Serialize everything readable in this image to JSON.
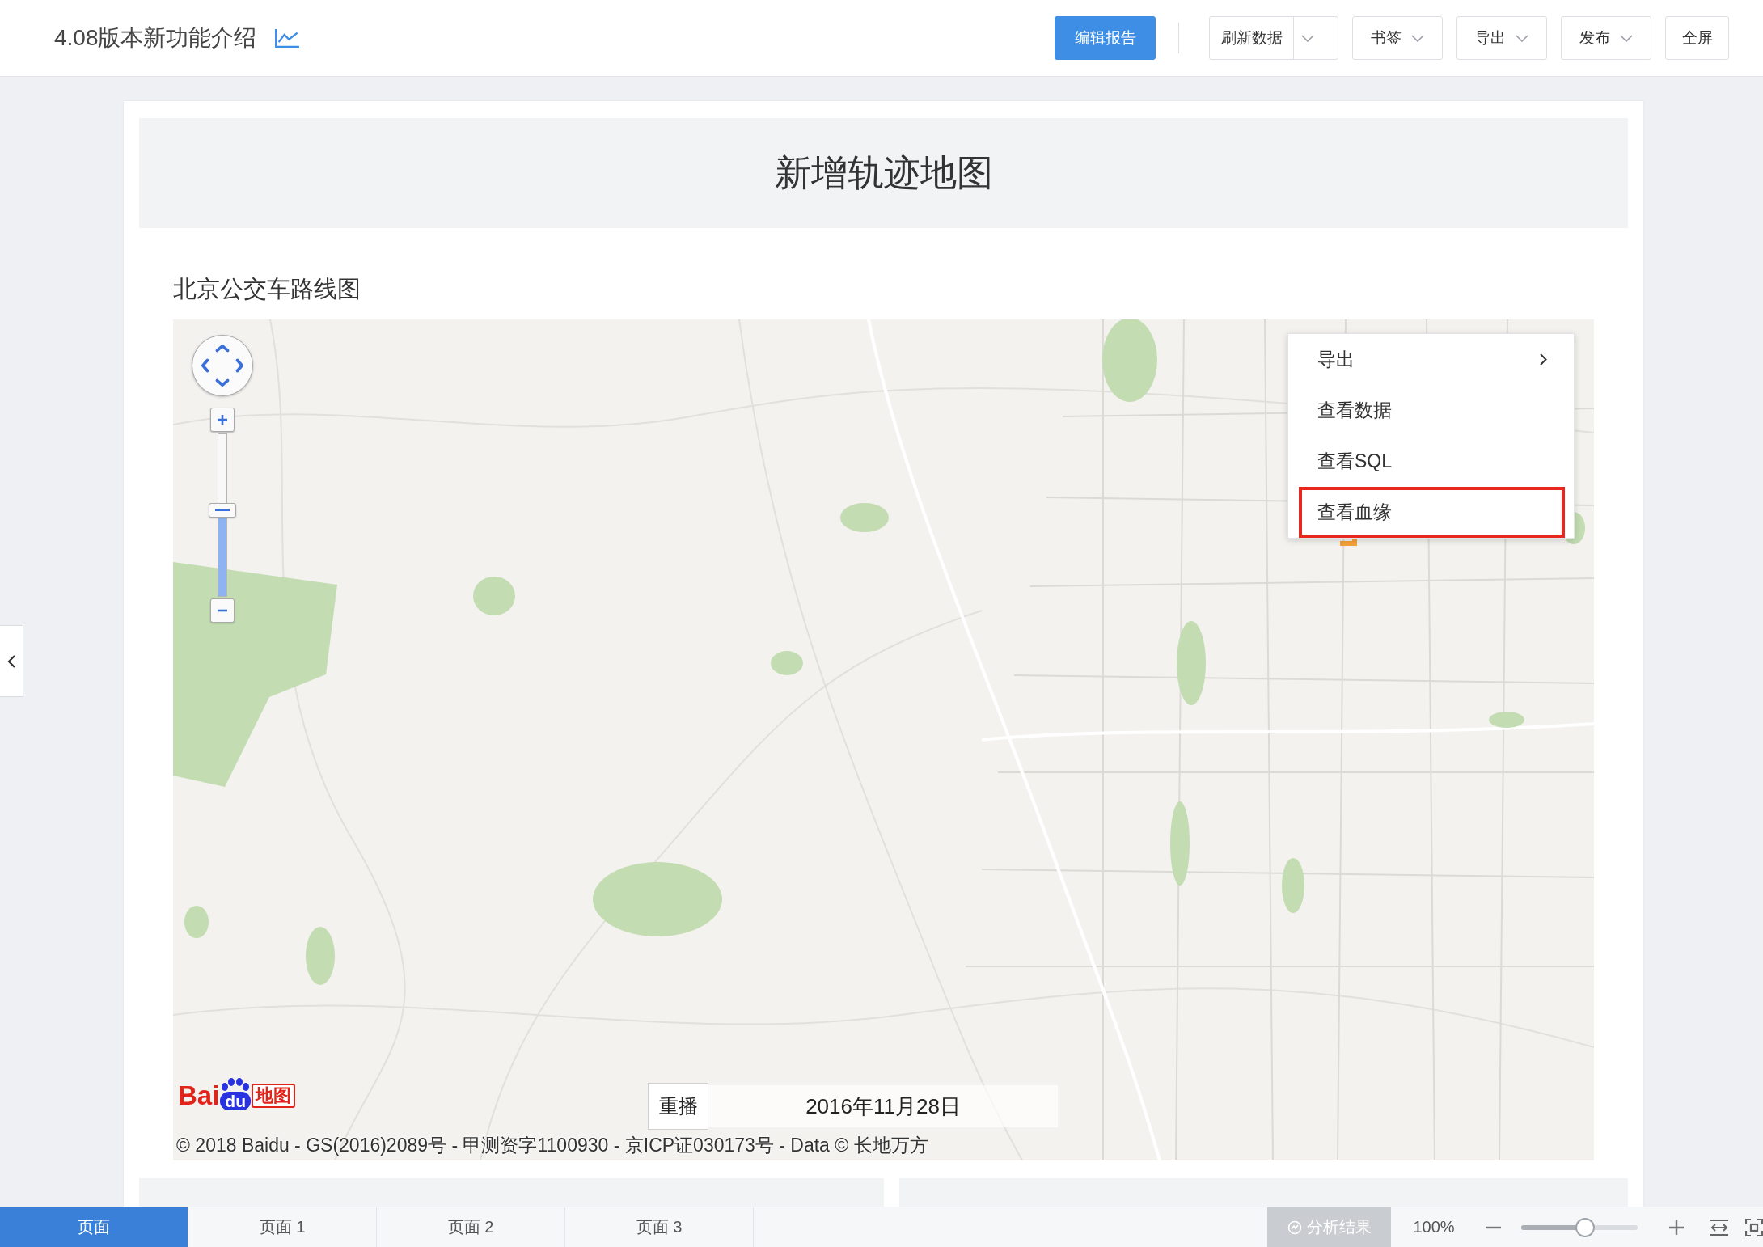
{
  "header": {
    "title": "4.08版本新功能介绍",
    "buttons": [
      {
        "label": "编辑报告",
        "kind": "primary"
      },
      {
        "label": "刷新数据",
        "kind": "split"
      },
      {
        "label": "书签",
        "kind": "dropdown"
      },
      {
        "label": "导出",
        "kind": "dropdown"
      },
      {
        "label": "发布",
        "kind": "dropdown"
      },
      {
        "label": "全屏",
        "kind": "plain"
      }
    ]
  },
  "report": {
    "banner_title": "新增轨迹地图",
    "map_widget": {
      "title": "北京公交车路线图",
      "zoom_slider": {
        "level": 0.53
      },
      "logo": {
        "text": "Bai",
        "badge": "du",
        "suffix": "地图"
      },
      "replay_button": "重播",
      "date": "2016年11月28日",
      "copyright": "© 2018 Baidu - GS(2016)2089号 - 甲测资字1100930 - 京ICP证030173号 - Data © 长地万方",
      "context_menu": [
        {
          "label": "导出",
          "submenu": true,
          "highlighted": false
        },
        {
          "label": "查看数据",
          "submenu": false,
          "highlighted": false
        },
        {
          "label": "查看SQL",
          "submenu": false,
          "highlighted": false
        },
        {
          "label": "查看血缘",
          "submenu": false,
          "highlighted": true
        }
      ]
    }
  },
  "page_tabs": [
    {
      "label": "页面",
      "selected": true
    },
    {
      "label": "页面 1",
      "selected": false
    },
    {
      "label": "页面 2",
      "selected": false
    },
    {
      "label": "页面 3",
      "selected": false
    }
  ],
  "footer": {
    "analysis_button": {
      "label": "分析结果",
      "disabled": true
    },
    "zoom_reading": "100%",
    "zoom_slider": {
      "level": 0.55
    }
  }
}
